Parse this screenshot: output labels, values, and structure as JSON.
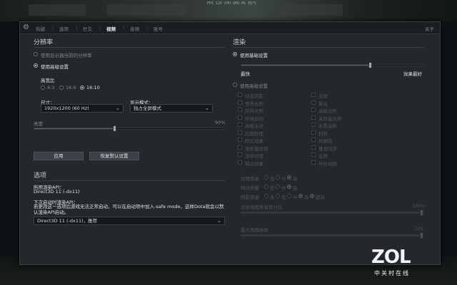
{
  "overlay": {
    "perf": "FPS 120 CPU  GPU  0% 65°C",
    "watermark": "ZOL",
    "watermark_sub": "中关村在线"
  },
  "tabs": [
    "热键",
    "选项",
    "社交",
    "视频",
    "音频",
    "账号"
  ],
  "active_tab": "视频",
  "close_label": "关于",
  "resolution": {
    "title": "分辨率",
    "use_desktop": "使用显示器当前的分辨率",
    "use_advanced": "使用高级设置",
    "aspect_label": "高宽比",
    "aspects": [
      "4:3",
      "16:9",
      "16:10"
    ],
    "size_label": "尺寸：",
    "size_value": "1920x1200 (60 Hz)",
    "mode_label": "显示模式：",
    "mode_value": "独占全屏模式",
    "brightness_label": "亮度",
    "brightness_pct": "90%",
    "brightness_value": 0.42,
    "apply": "应用",
    "reset": "恢复默认设置"
  },
  "options": {
    "title": "选项",
    "api_label": "所用渲染API：",
    "api_value": "Direct3D 11 (-dx11)",
    "next_label": "下次启动时渲染API：",
    "next_note": "若更改这一选项后游戏无法正常启动，可以在启动项中加入-safe mode，这样Dota就会以默认渲染API启动。",
    "select_value": "Direct3D 11 (-dx11)，推荐"
  },
  "render": {
    "title": "渲染",
    "use_basic": "使用基础设置",
    "quality_value": 0.7,
    "fastest": "最快",
    "best": "效果最好",
    "use_advanced": "使用高级设置",
    "checks_left": [
      "动态阴影",
      "世界光照",
      "环境光照",
      "环境遮挡",
      "高级水效",
      "后期处理",
      "附加效果",
      "高质量纹理",
      "渲染纹理",
      "描边效果"
    ],
    "checks_right": [
      "全屏",
      "雾化",
      "高级光照",
      "高质量光照",
      "多重采样",
      "材质",
      "抗锯齿",
      "垂直同步",
      "全屏",
      "树叶动画"
    ],
    "radio_rows": [
      {
        "label": "纹理质量",
        "opts": [
          "低",
          "中",
          "高"
        ]
      },
      {
        "label": "特效质量",
        "opts": [
          "低",
          "中",
          "高"
        ]
      },
      {
        "label": "阴影质量",
        "opts": [
          "关",
          "低",
          "中",
          "高",
          "超高"
        ]
      }
    ],
    "slider1_label": "渲染画面质量百分比",
    "slider1_value": "100%",
    "slider2_label": "最大画面帧数",
    "slider2_value": "120"
  }
}
